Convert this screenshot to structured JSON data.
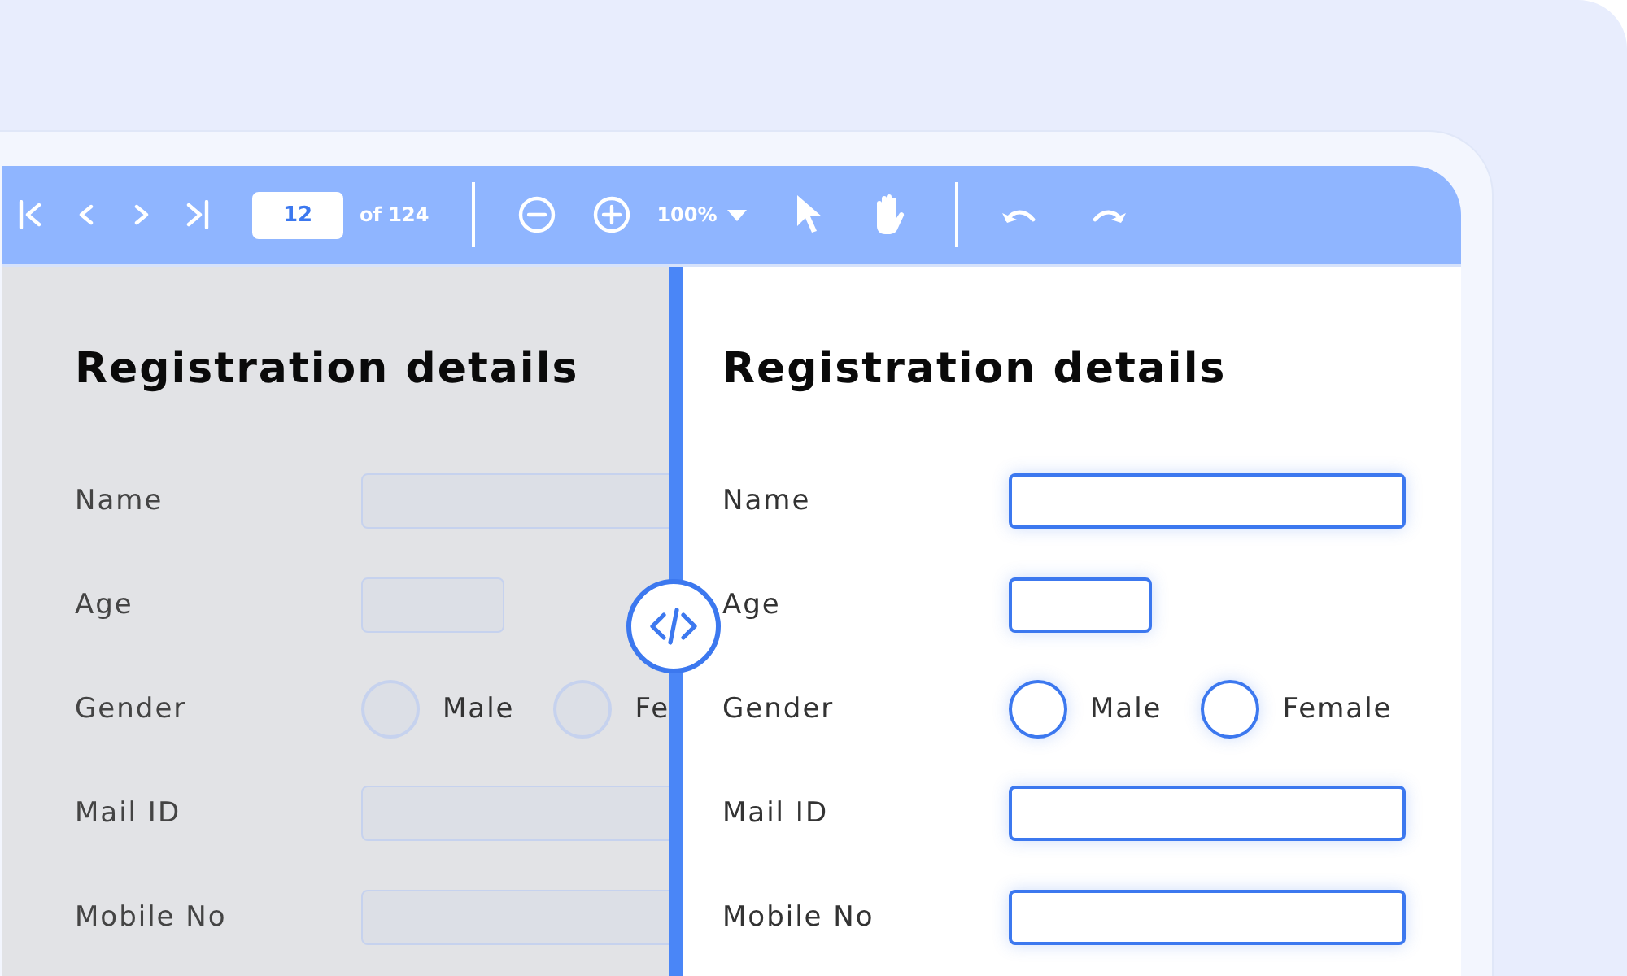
{
  "toolbar": {
    "page": "12",
    "page_count": "of 124",
    "zoom": "100%"
  },
  "panes": [
    {
      "disabled": true,
      "title": "Registration details",
      "fields": [
        {
          "label": "Name",
          "kind": "text"
        },
        {
          "label": "Age",
          "kind": "short"
        },
        {
          "label": "Gender",
          "kind": "radio",
          "options": [
            {
              "label": "Male",
              "selected": false
            },
            {
              "label": "Fe",
              "selected": false
            }
          ]
        },
        {
          "label": "Mail ID",
          "kind": "text"
        },
        {
          "label": "Mobile No",
          "kind": "text"
        }
      ]
    },
    {
      "disabled": false,
      "title": "Registration details",
      "fields": [
        {
          "label": "Name",
          "kind": "text"
        },
        {
          "label": "Age",
          "kind": "short"
        },
        {
          "label": "Gender",
          "kind": "radio",
          "options": [
            {
              "label": "Male",
              "selected": false
            },
            {
              "label": "Female",
              "selected": false
            }
          ]
        },
        {
          "label": "Mail ID",
          "kind": "text"
        },
        {
          "label": "Mobile No",
          "kind": "text"
        }
      ]
    }
  ]
}
